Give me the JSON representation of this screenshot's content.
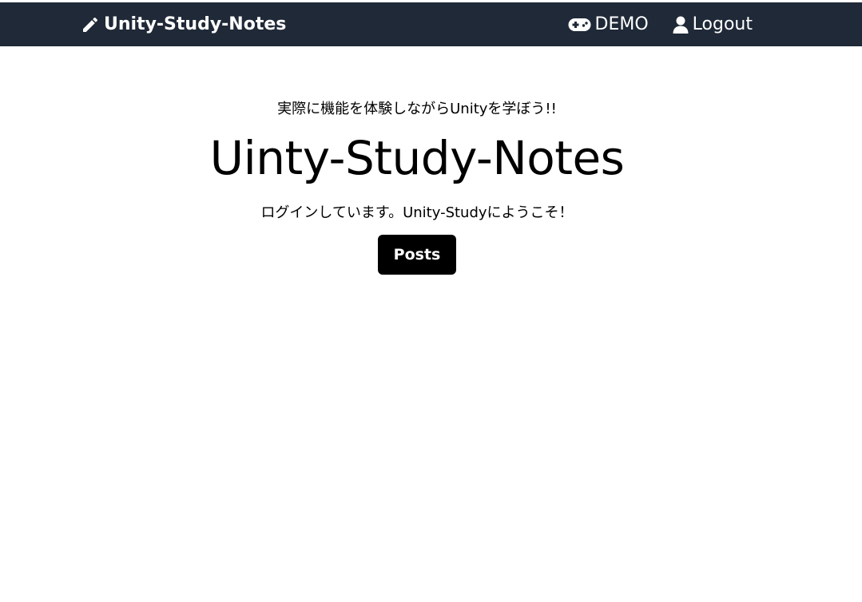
{
  "header": {
    "brand_label": "Unity-Study-Notes",
    "brand_icon": "pencil-icon",
    "nav": {
      "demo_label": "DEMO",
      "demo_icon": "gamepad-icon",
      "logout_label": "Logout",
      "logout_icon": "user-icon"
    },
    "bg_color": "#1f2937"
  },
  "hero": {
    "tagline": "実際に機能を体験しながらUnityを学ぼう!!",
    "title": "Uinty-Study-Notes",
    "welcome": "ログインしています。Unity-Studyにようこそ！",
    "button_label": "Posts"
  }
}
